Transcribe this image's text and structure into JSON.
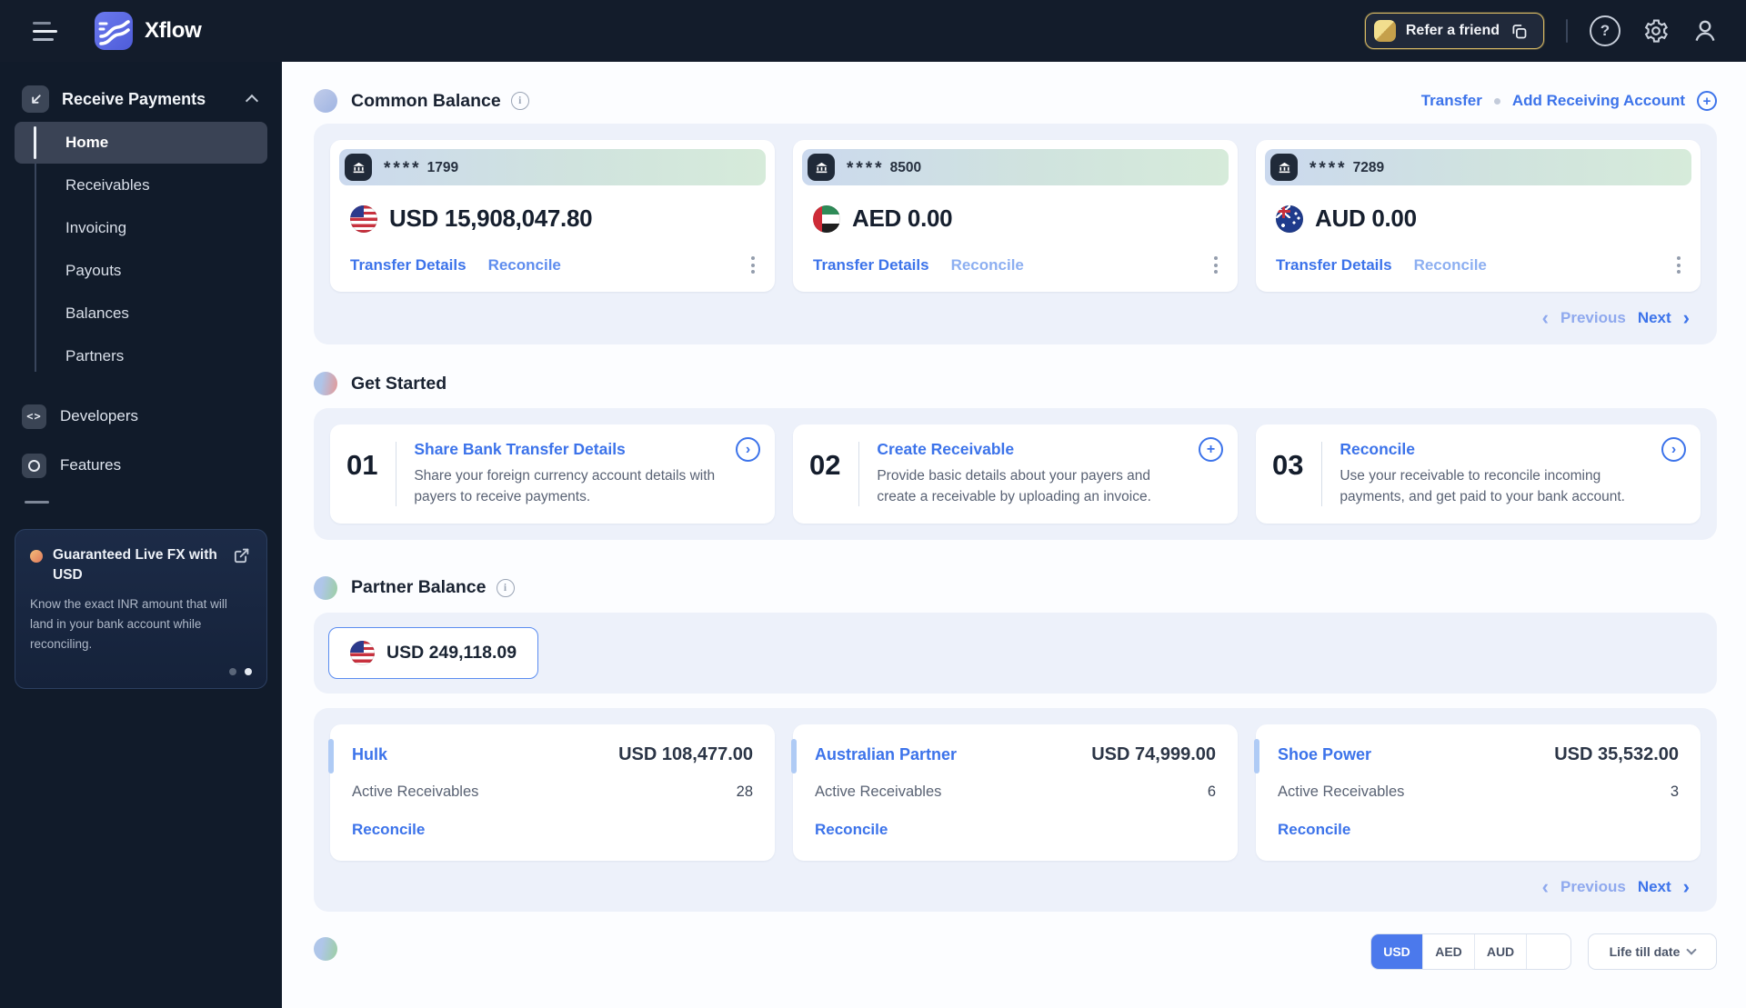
{
  "icons": {
    "info": "i",
    "question": "?",
    "plus": "+",
    "chevron_right": "›",
    "chevron_left": "‹"
  },
  "navbar": {
    "brand": "Xflow",
    "refer_button": "Refer a friend"
  },
  "sidebar": {
    "section_label": "Receive Payments",
    "items": [
      {
        "label": "Home",
        "active": true
      },
      {
        "label": "Receivables",
        "active": false
      },
      {
        "label": "Invoicing",
        "active": false
      },
      {
        "label": "Payouts",
        "active": false
      },
      {
        "label": "Balances",
        "active": false
      },
      {
        "label": "Partners",
        "active": false
      }
    ],
    "secondary": [
      {
        "label": "Developers"
      },
      {
        "label": "Features"
      }
    ],
    "promo": {
      "title": "Guaranteed Live FX with USD",
      "body": "Know the exact INR amount that will land in your bank account while reconciling.",
      "dot_count": 2,
      "active_dot": 2
    }
  },
  "common_balance": {
    "title": "Common Balance",
    "actions": {
      "transfer": "Transfer",
      "add_account": "Add Receiving Account"
    },
    "cards": [
      {
        "masked_stars": "****",
        "masked_digits": "1799",
        "flag": "us",
        "amount": "USD 15,908,047.80",
        "link_primary": "Transfer Details",
        "link_secondary": "Reconcile"
      },
      {
        "masked_stars": "****",
        "masked_digits": "8500",
        "flag": "ae",
        "amount": "AED 0.00",
        "link_primary": "Transfer Details",
        "link_secondary": "Reconcile"
      },
      {
        "masked_stars": "****",
        "masked_digits": "7289",
        "flag": "au",
        "amount": "AUD 0.00",
        "link_primary": "Transfer Details",
        "link_secondary": "Reconcile"
      }
    ],
    "pagination": {
      "previous": "Previous",
      "next": "Next"
    }
  },
  "get_started": {
    "title": "Get Started",
    "steps": [
      {
        "number": "01",
        "title": "Share Bank Transfer Details",
        "icon": "chevron-circle",
        "icon_glyph": "›",
        "description": "Share your foreign currency account details with payers to receive payments."
      },
      {
        "number": "02",
        "title": "Create Receivable",
        "icon": "plus-circle",
        "icon_glyph": "+",
        "description": "Provide basic details about your payers and create a receivable by uploading an invoice."
      },
      {
        "number": "03",
        "title": "Reconcile",
        "icon": "chevron-circle",
        "icon_glyph": "›",
        "description": "Use your receivable to reconcile incoming payments, and get paid to your bank account."
      }
    ]
  },
  "partner_balance": {
    "title": "Partner Balance",
    "selected_balance": "USD 249,118.09",
    "selected_flag": "us",
    "receivables_label": "Active Receivables",
    "partners": [
      {
        "name": "Hulk",
        "amount": "USD 108,477.00",
        "active_receivables": "28",
        "link": "Reconcile"
      },
      {
        "name": "Australian Partner",
        "amount": "USD 74,999.00",
        "active_receivables": "6",
        "link": "Reconcile"
      },
      {
        "name": "Shoe Power",
        "amount": "USD 35,532.00",
        "active_receivables": "3",
        "link": "Reconcile"
      }
    ],
    "pagination": {
      "previous": "Previous",
      "next": "Next"
    }
  },
  "bottom_bar": {
    "currency_tabs": [
      "USD",
      "AED",
      "AUD",
      ""
    ],
    "selected_tab": "USD",
    "date_filter": "Life till date"
  },
  "colors": {
    "accent_blue": "#3C73EA",
    "muted_blue": "#8FA9EE",
    "navbar_bg": "#131C2B",
    "sidebar_bg": "#111B2A",
    "panel_bg": "#EDF1FA",
    "gold_border": "#D9BA64",
    "dark_text": "#161F2E"
  }
}
